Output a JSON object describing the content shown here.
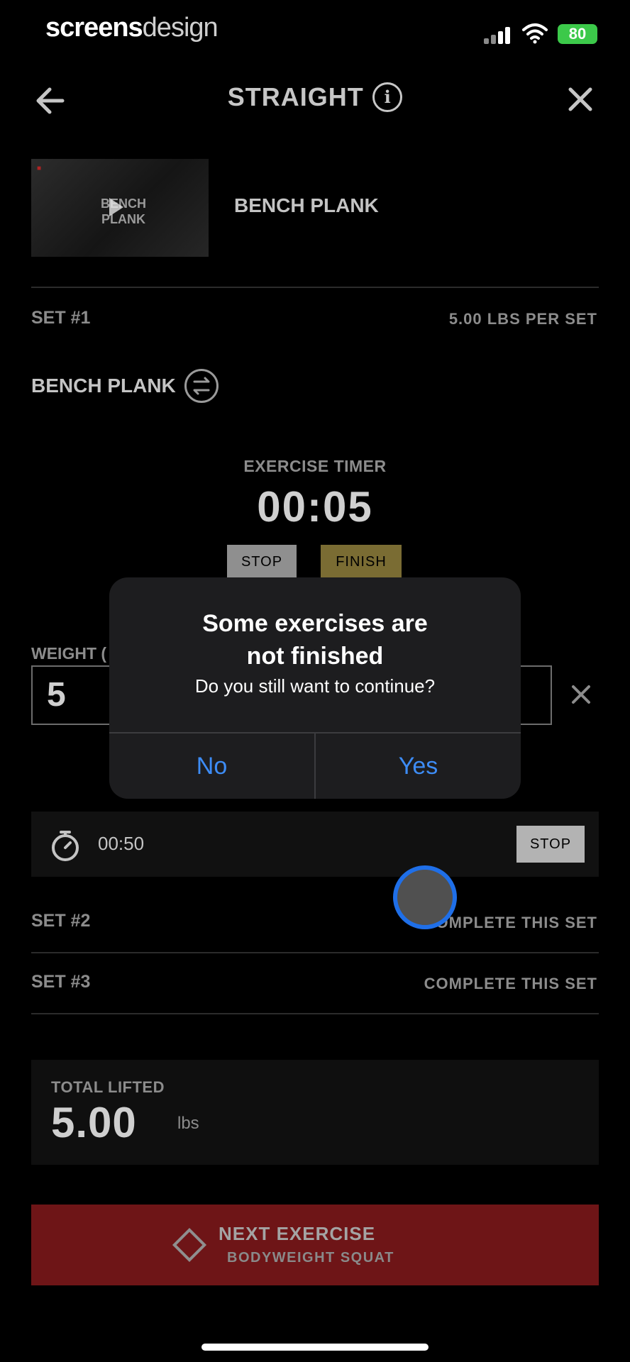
{
  "status_bar": {
    "brand_bold": "screens",
    "brand_light": "design",
    "battery": "80"
  },
  "header": {
    "title": "STRAIGHT",
    "back_icon": "arrow-left-icon",
    "info_icon": "info-icon",
    "close_icon": "close-icon"
  },
  "exercise": {
    "thumbnail_text": "BENCH PLANK",
    "name": "BENCH PLANK"
  },
  "set1": {
    "label": "SET #1",
    "lbs_per_set": "5.00 LBS PER SET",
    "exercise_name": "BENCH PLANK",
    "timer_label": "EXERCISE TIMER",
    "timer_value": "00:05",
    "stop_label": "STOP",
    "finish_label": "FINISH",
    "weight_label": "WEIGHT (",
    "weight_value": "5"
  },
  "rest": {
    "time": "00:50",
    "stop_label": "STOP"
  },
  "sets": [
    {
      "label": "SET #2",
      "action": "COMPLETE THIS SET"
    },
    {
      "label": "SET #3",
      "action": "COMPLETE THIS SET"
    }
  ],
  "total": {
    "label": "TOTAL LIFTED",
    "value": "5.00",
    "unit": "lbs"
  },
  "next": {
    "title": "NEXT EXERCISE",
    "subtitle": "BODYWEIGHT SQUAT"
  },
  "dialog": {
    "title_line1": "Some exercises are",
    "title_line2": "not finished",
    "message": "Do you still want to continue?",
    "no_label": "No",
    "yes_label": "Yes"
  },
  "colors": {
    "accent_red": "#6e1517",
    "finish_gold": "#7a6c33",
    "ios_blue": "#3d8cf5",
    "battery_green": "#3cc94a"
  }
}
